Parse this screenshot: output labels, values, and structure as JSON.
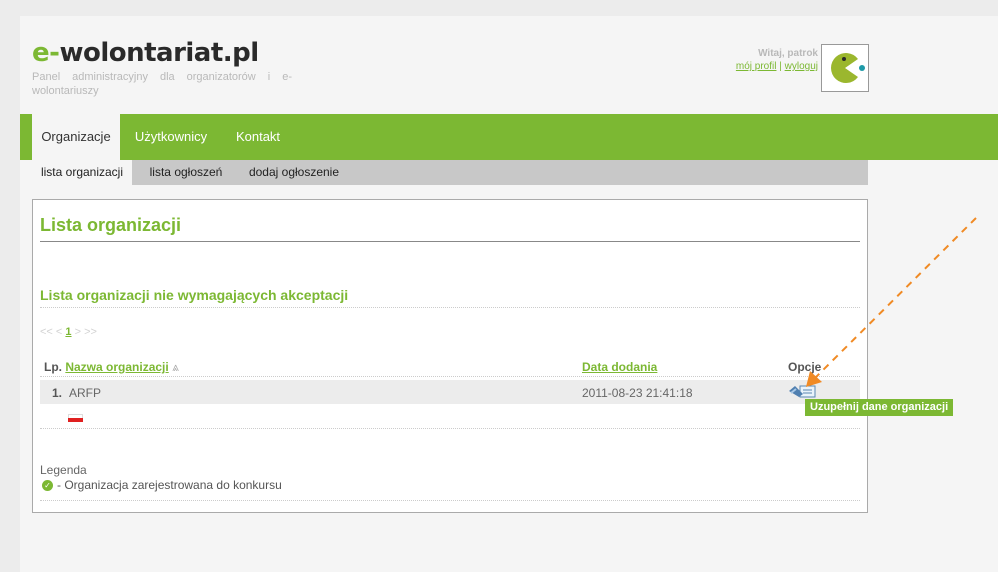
{
  "header": {
    "logo_prefix": "e-",
    "logo_main": "wolontariat.pl",
    "tagline": "Panel administracyjny dla organizatorów i e-wolontariuszy"
  },
  "user": {
    "greeting": "Witaj, patrok",
    "profile_link": "mój profil",
    "separator": "|",
    "logout_link": "wyloguj"
  },
  "main_nav": [
    "Organizacje",
    "Użytkownicy",
    "Kontakt"
  ],
  "sub_nav": [
    "lista organizacji",
    "lista ogłoszeń",
    "dodaj ogłoszenie"
  ],
  "page": {
    "title": "Lista organizacji",
    "section_title": "Lista organizacji nie wymagających akceptacji",
    "pager": {
      "first": "<<",
      "prev": "<",
      "current": "1",
      "next": ">",
      "last": ">>"
    },
    "table": {
      "col_lp": "Lp.",
      "col_name": "Nazwa organizacji",
      "sort_icon": "⩓",
      "col_date": "Data dodania",
      "col_options": "Opcje",
      "rows": [
        {
          "lp": "1.",
          "name": "ARFP",
          "date": "2011-08-23 21:41:18"
        }
      ]
    },
    "legend_title": "Legenda",
    "legend_item": "- Organizacja zarejestrowana do konkursu",
    "tooltip": "Uzupełnij dane organizacji"
  },
  "colors": {
    "accent": "#7cb833",
    "arrow": "#f08a24"
  },
  "icons": [
    "pacman-avatar-icon",
    "sort-up-icon",
    "poland-flag-icon",
    "edit-organization-icon",
    "check-circle-icon"
  ]
}
